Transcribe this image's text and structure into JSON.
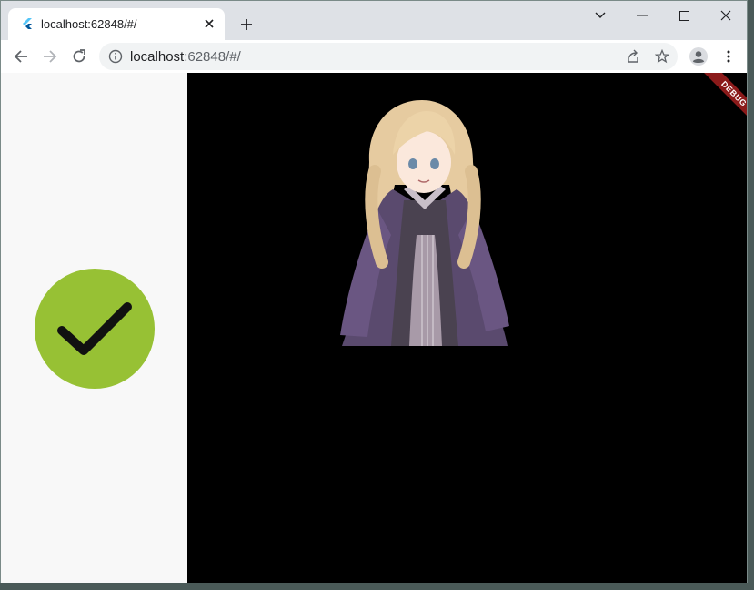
{
  "browser": {
    "tab": {
      "title": "localhost:62848/#/"
    },
    "address": {
      "host": "localhost",
      "rest": ":62848/#/"
    }
  },
  "app": {
    "debug_banner": "DEBUG",
    "status": {
      "icon": "checkmark-icon",
      "color": "#97c134"
    },
    "stage_background": "#000000"
  }
}
